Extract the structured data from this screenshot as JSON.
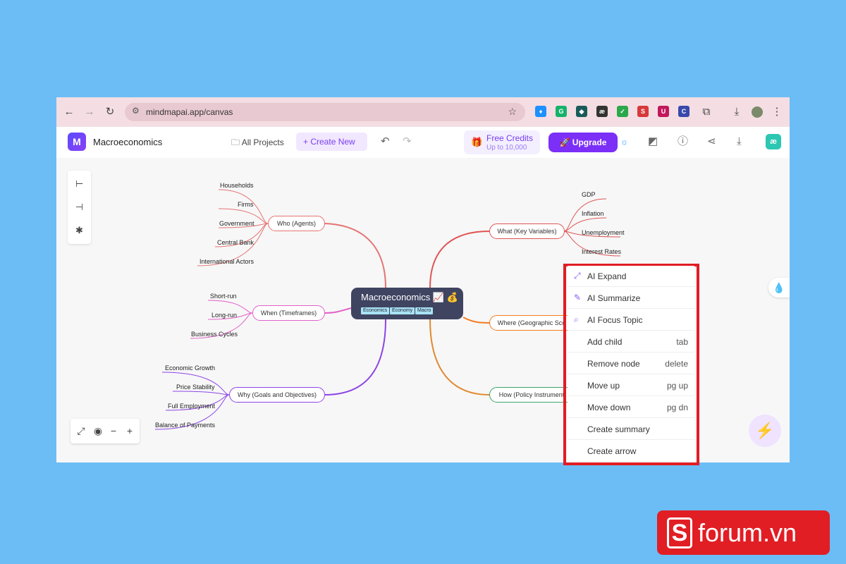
{
  "browser": {
    "url": "mindmapai.app/canvas",
    "extensions": [
      {
        "name": "dropbox-extension",
        "color": "#1e90ff",
        "glyph": "♦"
      },
      {
        "name": "grammarly-extension",
        "color": "#15b36b",
        "glyph": "G"
      },
      {
        "name": "extension-teal",
        "color": "#1a5a5a",
        "glyph": "◆"
      },
      {
        "name": "ae-extension",
        "color": "#333333",
        "glyph": "æ"
      },
      {
        "name": "extension-green",
        "color": "#2aa84a",
        "glyph": "✓"
      },
      {
        "name": "extension-red-s",
        "color": "#d63a3a",
        "glyph": "S"
      },
      {
        "name": "ublock-extension",
        "color": "#c2185b",
        "glyph": "U"
      },
      {
        "name": "extension-c",
        "color": "#3949ab",
        "glyph": "C"
      }
    ]
  },
  "header": {
    "app_title": "Macroeconomics",
    "all_projects": "All Projects",
    "create_new": "Create New",
    "free_credits": "Free Credits",
    "free_credits_sub": "Up to 10,000",
    "upgrade": "Upgrade",
    "avatar": "æ"
  },
  "mindmap": {
    "root": {
      "title": "Macroeconomics 📈 💰",
      "tags": [
        "Economics",
        "Economy",
        "Macro"
      ]
    },
    "branches": [
      {
        "label": "Who (Agents)",
        "color": "#e57373",
        "children": [
          "Households",
          "Firms",
          "Government",
          "Central Bank",
          "International Actors"
        ]
      },
      {
        "label": "When (Timeframes)",
        "color": "#e25fc9",
        "children": [
          "Short-run",
          "Long-run",
          "Business Cycles"
        ]
      },
      {
        "label": "Why (Goals and Objectives)",
        "color": "#8e44e6",
        "children": [
          "Economic Growth",
          "Price Stability",
          "Full Employment",
          "Balance of Payments"
        ]
      },
      {
        "label": "What (Key Variables)",
        "color": "#e05555",
        "children": [
          "GDP",
          "Inflation",
          "Unemployment",
          "Interest Rates"
        ]
      },
      {
        "label": "Where (Geographic Sco",
        "color": "#f27b1f",
        "children": []
      },
      {
        "label": "How (Policy Instrument",
        "color": "#3aa56b",
        "children": []
      }
    ]
  },
  "context_menu": {
    "items": [
      {
        "label": "AI Expand",
        "icon": "expand-icon",
        "shortcut": ""
      },
      {
        "label": "AI Summarize",
        "icon": "edit-icon",
        "shortcut": ""
      },
      {
        "label": "AI Focus Topic",
        "icon": "search-icon",
        "shortcut": ""
      },
      {
        "label": "Add child",
        "icon": "",
        "shortcut": "tab"
      },
      {
        "label": "Remove node",
        "icon": "",
        "shortcut": "delete"
      },
      {
        "label": "Move up",
        "icon": "",
        "shortcut": "pg up"
      },
      {
        "label": "Move down",
        "icon": "",
        "shortcut": "pg dn"
      },
      {
        "label": "Create summary",
        "icon": "",
        "shortcut": ""
      },
      {
        "label": "Create arrow",
        "icon": "",
        "shortcut": ""
      }
    ]
  },
  "watermark": {
    "letter": "S",
    "text": "forum.vn"
  },
  "colors": {
    "background": "#6cbdf5",
    "accent": "#7b2ff7",
    "highlight": "#e11d24"
  }
}
